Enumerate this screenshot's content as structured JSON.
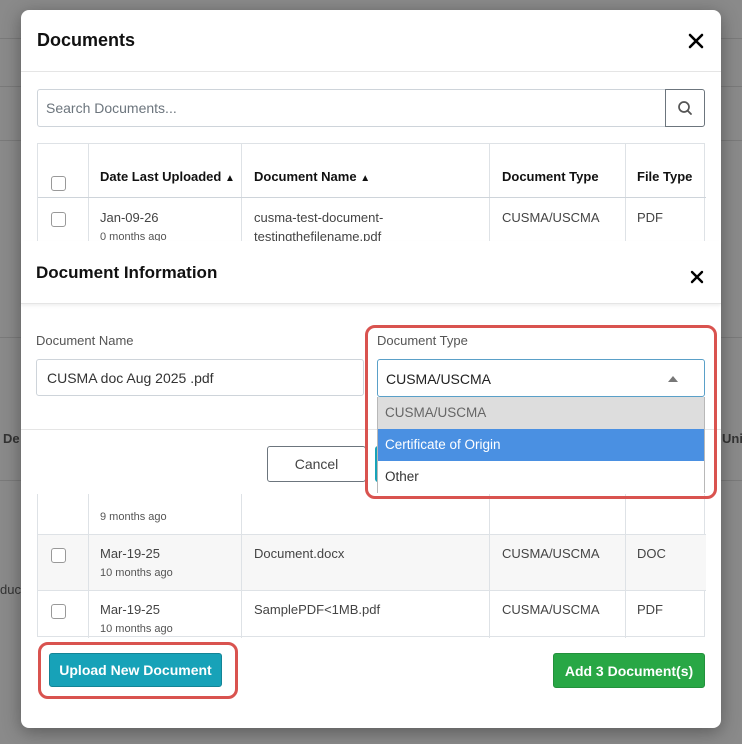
{
  "background": {
    "col_fragment_left": "De",
    "col_fragment_right": "Uni",
    "row_fragment_left": "duc"
  },
  "documents_modal": {
    "title": "Documents",
    "close_symbol": "✕",
    "search": {
      "placeholder": "Search Documents...",
      "icon": "search-icon"
    },
    "table": {
      "columns": [
        "Date Last Uploaded",
        "Document Name",
        "Document Type",
        "File Type"
      ],
      "sort_indicator": "⬍",
      "rows": [
        {
          "date": "Jan-09-26",
          "age": "0 months ago",
          "name_line1": "cusma-test-document-",
          "name_line2": "testingthefilename.pdf",
          "type": "CUSMA/USCMA",
          "file_type": "PDF"
        },
        {
          "date": "",
          "age": "9 months ago",
          "name_line1": "",
          "name_line2": "",
          "type": "",
          "file_type": ""
        },
        {
          "date": "Mar-19-25",
          "age": "10 months ago",
          "name_line1": "Document.docx",
          "name_line2": "",
          "type": "CUSMA/USCMA",
          "file_type": "DOC"
        },
        {
          "date": "Mar-19-25",
          "age": "10 months ago",
          "name_line1": "SamplePDF<1MB.pdf",
          "name_line2": "",
          "type": "CUSMA/USCMA",
          "file_type": "PDF"
        }
      ]
    },
    "upload_button": "Upload New Document",
    "add_button": "Add 3 Document(s)"
  },
  "info_modal": {
    "title": "Document Information",
    "close_symbol": "✕",
    "name_label": "Document Name",
    "name_value": "CUSMA doc Aug 2025 .pdf",
    "type_label": "Document Type",
    "type_value": "CUSMA/USCMA",
    "type_options": [
      "CUSMA/USCMA",
      "Certificate of Origin",
      "Other"
    ],
    "cancel_button": "Cancel"
  },
  "colors": {
    "highlight": "#d9534f",
    "option_hover": "#4a90e2",
    "upload_button": "#17a2b8",
    "add_button": "#28a745"
  }
}
